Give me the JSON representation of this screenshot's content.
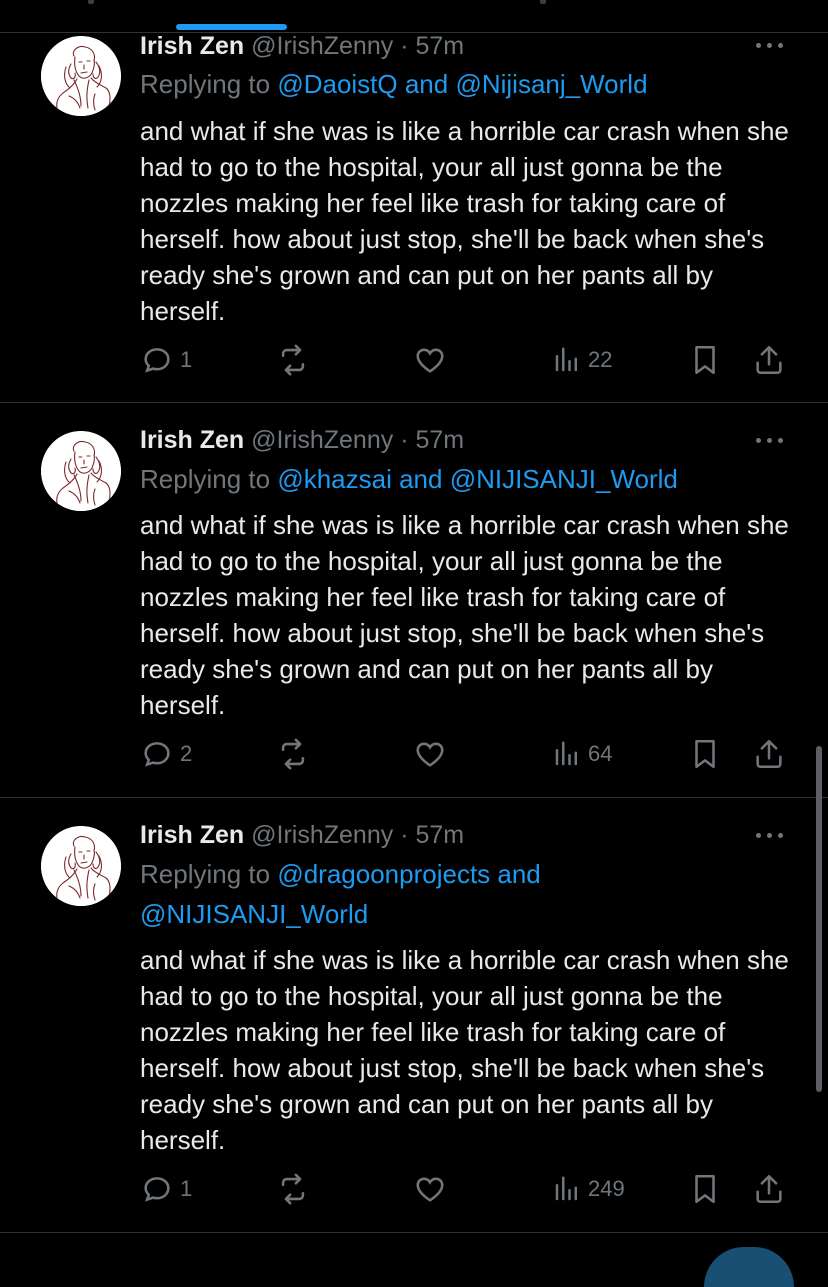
{
  "colors": {
    "background": "#000000",
    "text": "#e7e9ea",
    "muted": "#71767b",
    "accent": "#1d9bf0",
    "divider": "#2f3336"
  },
  "tweets": [
    {
      "name": "Irish Zen",
      "handle": "@IrishZenny",
      "separator": "·",
      "time": "57m",
      "replying_prefix": "Replying to",
      "replying_lines": [
        "@DaoistQ and @Nijisanj_World"
      ],
      "body": "and what if she was is like a horrible car crash when she had to go to the hospital, your all just gonna be the nozzles making her feel like trash for taking care of herself. how about just stop, she'll be back when she's ready she's grown and can put on her pants all by herself.",
      "replies": "1",
      "views": "22",
      "icons": [
        "comment-icon",
        "retweet-icon",
        "heart-icon",
        "views-icon",
        "bookmark-icon",
        "share-icon",
        "more-icon"
      ]
    },
    {
      "name": "Irish Zen",
      "handle": "@IrishZenny",
      "separator": "·",
      "time": "57m",
      "replying_prefix": "Replying to",
      "replying_lines": [
        "@khazsai and @NIJISANJI_World"
      ],
      "body": "and what if she was is like a horrible car crash when she had to go to the hospital, your all just gonna be the nozzles making her feel like trash for taking care of herself. how about just stop, she'll be back when she's ready she's grown and can put on her pants all by herself.",
      "replies": "2",
      "views": "64",
      "icons": [
        "comment-icon",
        "retweet-icon",
        "heart-icon",
        "views-icon",
        "bookmark-icon",
        "share-icon",
        "more-icon"
      ]
    },
    {
      "name": "Irish Zen",
      "handle": "@IrishZenny",
      "separator": "·",
      "time": "57m",
      "replying_prefix": "Replying to",
      "replying_lines": [
        "@dragoonprojects and",
        "@NIJISANJI_World"
      ],
      "body": "and what if she was is like a horrible car crash when she had to go to the hospital, your all just gonna be the nozzles making her feel like trash for taking care of herself. how about just stop, she'll be back when she's ready she's grown and can put on her pants all by herself.",
      "replies": "1",
      "views": "249",
      "icons": [
        "comment-icon",
        "retweet-icon",
        "heart-icon",
        "views-icon",
        "bookmark-icon",
        "share-icon",
        "more-icon"
      ]
    }
  ]
}
